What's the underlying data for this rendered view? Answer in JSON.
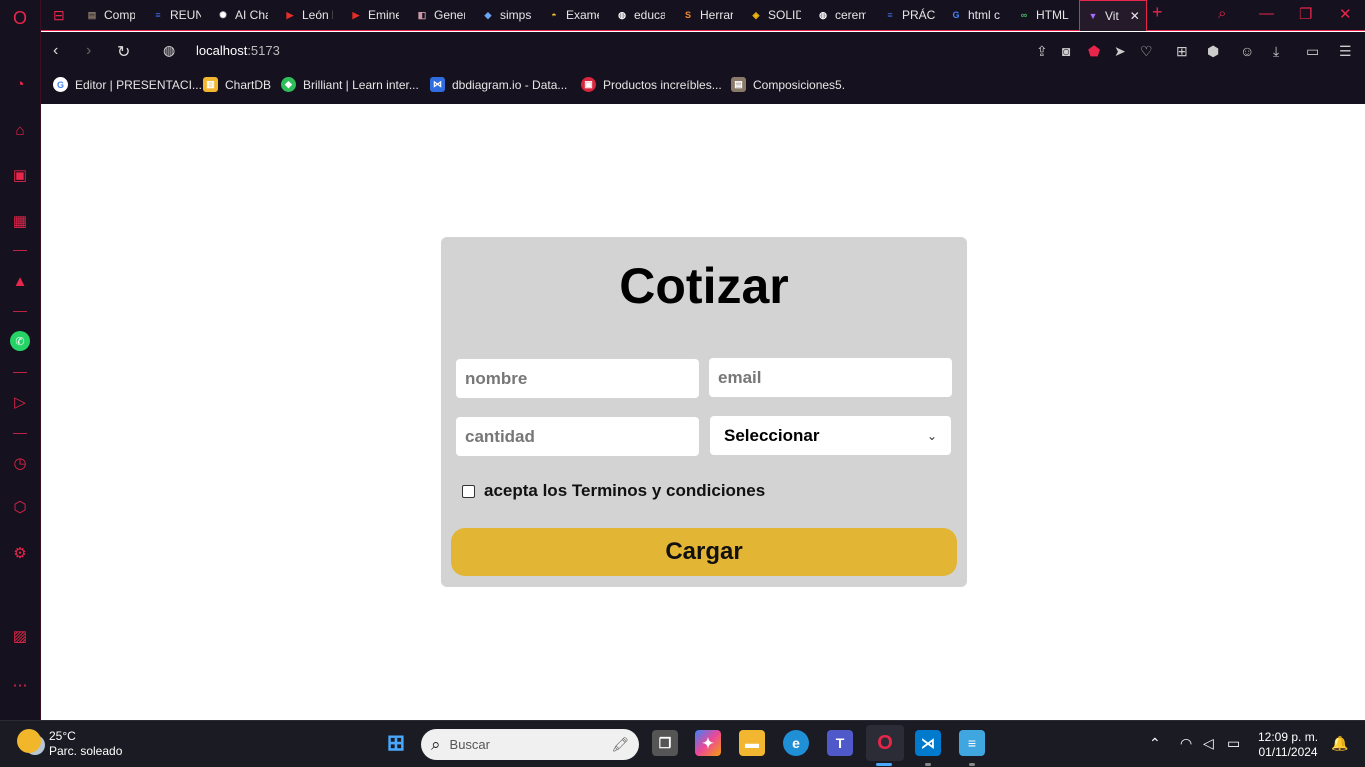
{
  "tabs": [
    {
      "label": "Comp",
      "icon": "gitlab-icon",
      "color": "#8a7a6a"
    },
    {
      "label": "REUN",
      "icon": "docs-icon",
      "color": "#3a6ee8"
    },
    {
      "label": "AI Cha",
      "icon": "openai-icon",
      "color": "#ffffff"
    },
    {
      "label": "León l",
      "icon": "youtube-icon",
      "color": "#e52d27"
    },
    {
      "label": "Emine",
      "icon": "youtube-icon",
      "color": "#e52d27"
    },
    {
      "label": "Gener",
      "icon": "image-icon",
      "color": "#c9a"
    },
    {
      "label": "simps",
      "icon": "diamond-icon",
      "color": "#6aa6f0"
    },
    {
      "label": "Exame",
      "icon": "hat-icon",
      "color": "#f2c230"
    },
    {
      "label": "educa",
      "icon": "globe-icon",
      "color": "#ffffff"
    },
    {
      "label": "Herrar",
      "icon": "sublime-icon",
      "color": "#f58b2a"
    },
    {
      "label": "SOLID",
      "icon": "binance-icon",
      "color": "#f0b90b"
    },
    {
      "label": "cerem",
      "icon": "globe-icon",
      "color": "#ffffff"
    },
    {
      "label": "PRÁCT",
      "icon": "docs-icon",
      "color": "#3a6ee8"
    },
    {
      "label": "html c",
      "icon": "google-icon",
      "color": "#4285f4"
    },
    {
      "label": "HTML",
      "icon": "link-icon",
      "color": "#3dbb6b"
    },
    {
      "label": "Vit",
      "icon": "vite-icon",
      "color": "#a66cff",
      "active": true
    }
  ],
  "address": {
    "host": "localhost",
    "port": ":5173"
  },
  "bookmarks": [
    {
      "label": "Editor | PRESENTACI...",
      "icon": "google-icon"
    },
    {
      "label": "ChartDB",
      "icon": "chartdb-icon"
    },
    {
      "label": "Brilliant | Learn inter...",
      "icon": "brilliant-icon"
    },
    {
      "label": "dbdiagram.io - Data...",
      "icon": "dbdiagram-icon"
    },
    {
      "label": "Productos increíbles...",
      "icon": "shop-icon"
    },
    {
      "label": "Composiciones5.",
      "icon": "folder-icon"
    }
  ],
  "form": {
    "title": "Cotizar",
    "nombre_placeholder": "nombre",
    "email_placeholder": "email",
    "cantidad_placeholder": "cantidad",
    "select_value": "Seleccionar",
    "terms_label": "acepta los Terminos y condiciones",
    "submit_label": "Cargar"
  },
  "taskbar": {
    "temperature": "25°C",
    "weather": "Parc. soleado",
    "search_placeholder": "Buscar",
    "time": "12:09 p. m.",
    "date": "01/11/2024"
  },
  "colors": {
    "accent": "#e8254b",
    "chrome_bg": "#16111e",
    "card_bg": "#d3d3d3",
    "button_bg": "#e2b534"
  }
}
